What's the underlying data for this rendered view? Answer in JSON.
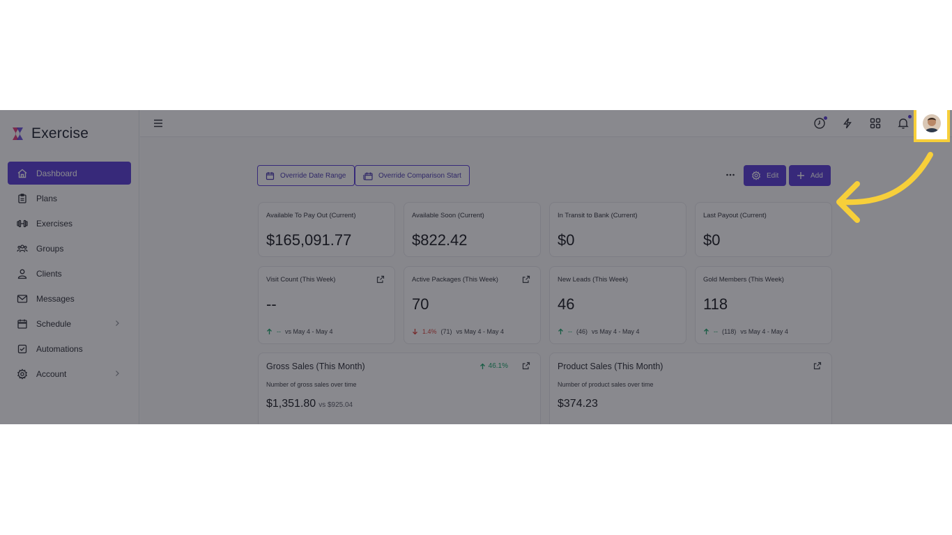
{
  "app": {
    "name": "Exercise"
  },
  "sidebar": {
    "items": [
      {
        "label": "Dashboard",
        "icon": "home-icon",
        "active": true,
        "has_chevron": false
      },
      {
        "label": "Plans",
        "icon": "clipboard-icon",
        "active": false,
        "has_chevron": false
      },
      {
        "label": "Exercises",
        "icon": "dumbbell-icon",
        "active": false,
        "has_chevron": false
      },
      {
        "label": "Groups",
        "icon": "users-group-icon",
        "active": false,
        "has_chevron": false
      },
      {
        "label": "Clients",
        "icon": "user-icon",
        "active": false,
        "has_chevron": false
      },
      {
        "label": "Messages",
        "icon": "mail-icon",
        "active": false,
        "has_chevron": false
      },
      {
        "label": "Schedule",
        "icon": "calendar-icon",
        "active": false,
        "has_chevron": true
      },
      {
        "label": "Automations",
        "icon": "checkbox-icon",
        "active": false,
        "has_chevron": false
      },
      {
        "label": "Account",
        "icon": "gear-icon",
        "active": false,
        "has_chevron": true
      }
    ]
  },
  "topbar": {
    "icons": [
      "clock-icon",
      "lightning-icon",
      "apps-grid-icon",
      "bell-icon",
      "avatar"
    ]
  },
  "toolbar": {
    "override_date_range": "Override Date Range",
    "override_comparison_start": "Override Comparison Start",
    "edit_label": "Edit",
    "add_label": "Add"
  },
  "stats_row1": [
    {
      "label": "Available To Pay Out (Current)",
      "value": "$165,091.77"
    },
    {
      "label": "Available Soon (Current)",
      "value": "$822.42"
    },
    {
      "label": "In Transit to Bank (Current)",
      "value": "$0"
    },
    {
      "label": "Last Payout (Current)",
      "value": "$0"
    }
  ],
  "stats_row2": [
    {
      "label": "Visit Count (This Week)",
      "value": "--",
      "change": "--",
      "prev": "",
      "vs": "vs May 4 - May 4",
      "trend": "up"
    },
    {
      "label": "Active Packages (This Week)",
      "value": "70",
      "change": "1.4%",
      "prev": "(71)",
      "vs": "vs May 4 - May 4",
      "trend": "down"
    },
    {
      "label": "New Leads (This Week)",
      "value": "46",
      "change": "--",
      "prev": "(46)",
      "vs": "vs May 4 - May 4",
      "trend": "up"
    },
    {
      "label": "Gold Members (This Week)",
      "value": "118",
      "change": "--",
      "prev": "(118)",
      "vs": "vs May 4 - May 4",
      "trend": "up"
    }
  ],
  "charts": {
    "gross": {
      "title": "Gross Sales (This Month)",
      "growth": "46.1%",
      "subtitle": "Number of gross sales over time",
      "value": "$1,351.80",
      "vs": "vs $925.04"
    },
    "product": {
      "title": "Product Sales (This Month)",
      "subtitle": "Number of product sales over time",
      "value": "$374.23"
    }
  },
  "colors": {
    "accent": "#5b3fd6",
    "highlight": "#f7cf3a",
    "up": "#1aa56a",
    "down": "#d9423b"
  }
}
